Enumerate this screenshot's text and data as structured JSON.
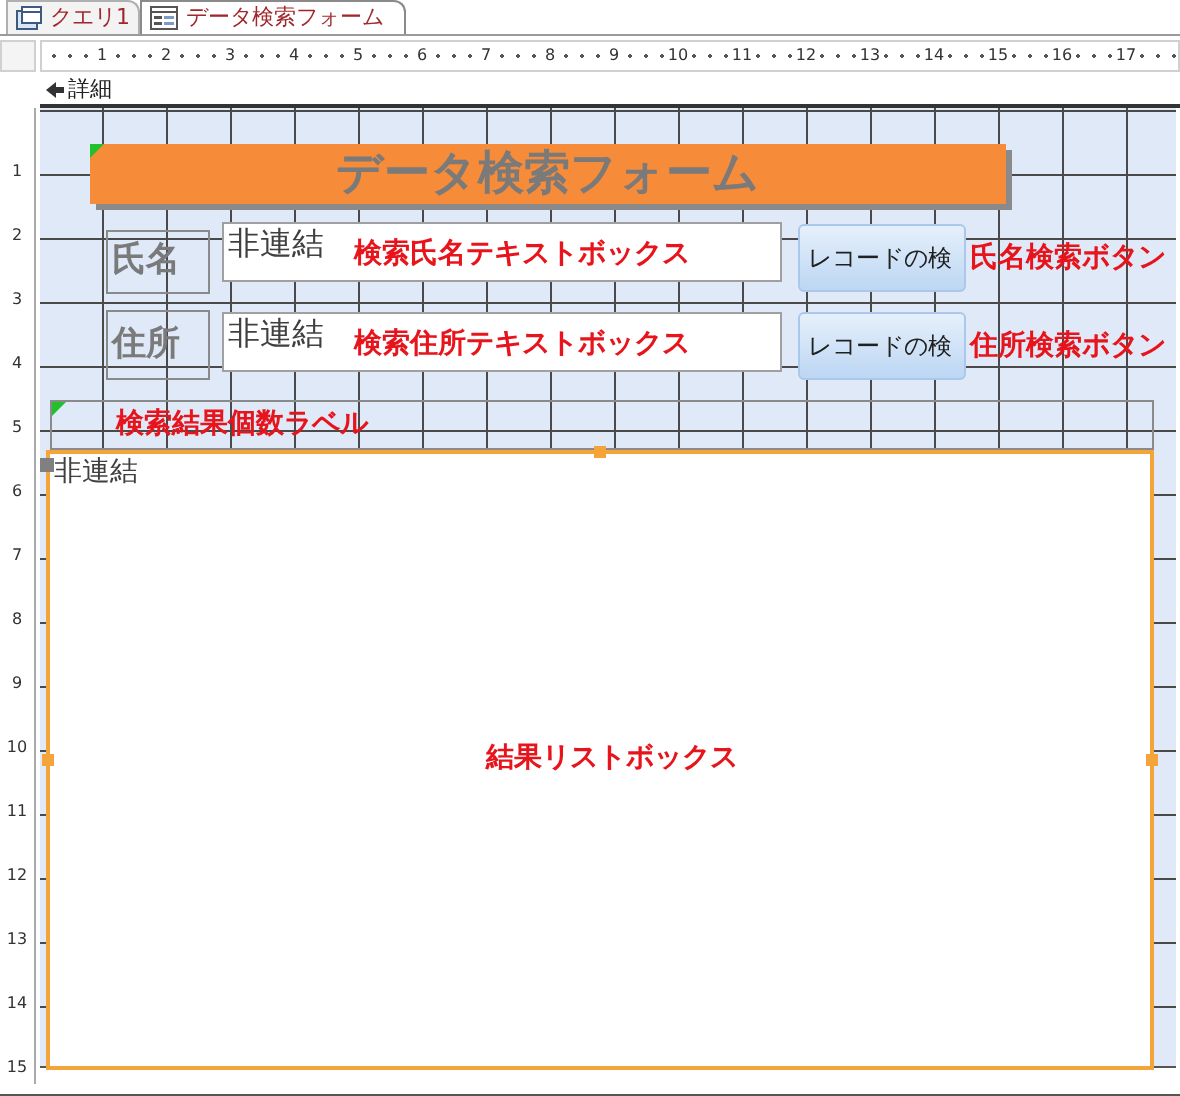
{
  "tabs": [
    {
      "label": "クエリ1",
      "kind": "query",
      "selected": false
    },
    {
      "label": "データ検索フォーム",
      "kind": "form",
      "selected": true
    }
  ],
  "rulers": {
    "horizontal": [
      "1",
      "2",
      "3",
      "4",
      "5",
      "6",
      "7",
      "8",
      "9",
      "10",
      "11",
      "12",
      "13",
      "14",
      "15",
      "16",
      "17"
    ],
    "vertical": [
      "1",
      "2",
      "3",
      "4",
      "5",
      "6",
      "7",
      "8",
      "9",
      "10",
      "11",
      "12",
      "13",
      "14",
      "15"
    ]
  },
  "section": {
    "label": "詳細"
  },
  "controls": [
    {
      "kind": "title",
      "text": "データ検索フォーム"
    },
    {
      "kind": "label",
      "text": "氏名"
    },
    {
      "kind": "textbox",
      "value": "非連結",
      "annotation": "検索氏名テキストボックス"
    },
    {
      "kind": "button",
      "text": "レコードの検",
      "annotation": "氏名検索ボタン"
    },
    {
      "kind": "label",
      "text": "住所"
    },
    {
      "kind": "textbox",
      "value": "非連結",
      "annotation": "検索住所テキストボックス"
    },
    {
      "kind": "button",
      "text": "レコードの検",
      "annotation": "住所検索ボタン"
    },
    {
      "kind": "frame",
      "annotation": "検索結果個数ラベル"
    },
    {
      "kind": "listbox",
      "value": "非連結",
      "annotation": "結果リストボックス"
    }
  ]
}
